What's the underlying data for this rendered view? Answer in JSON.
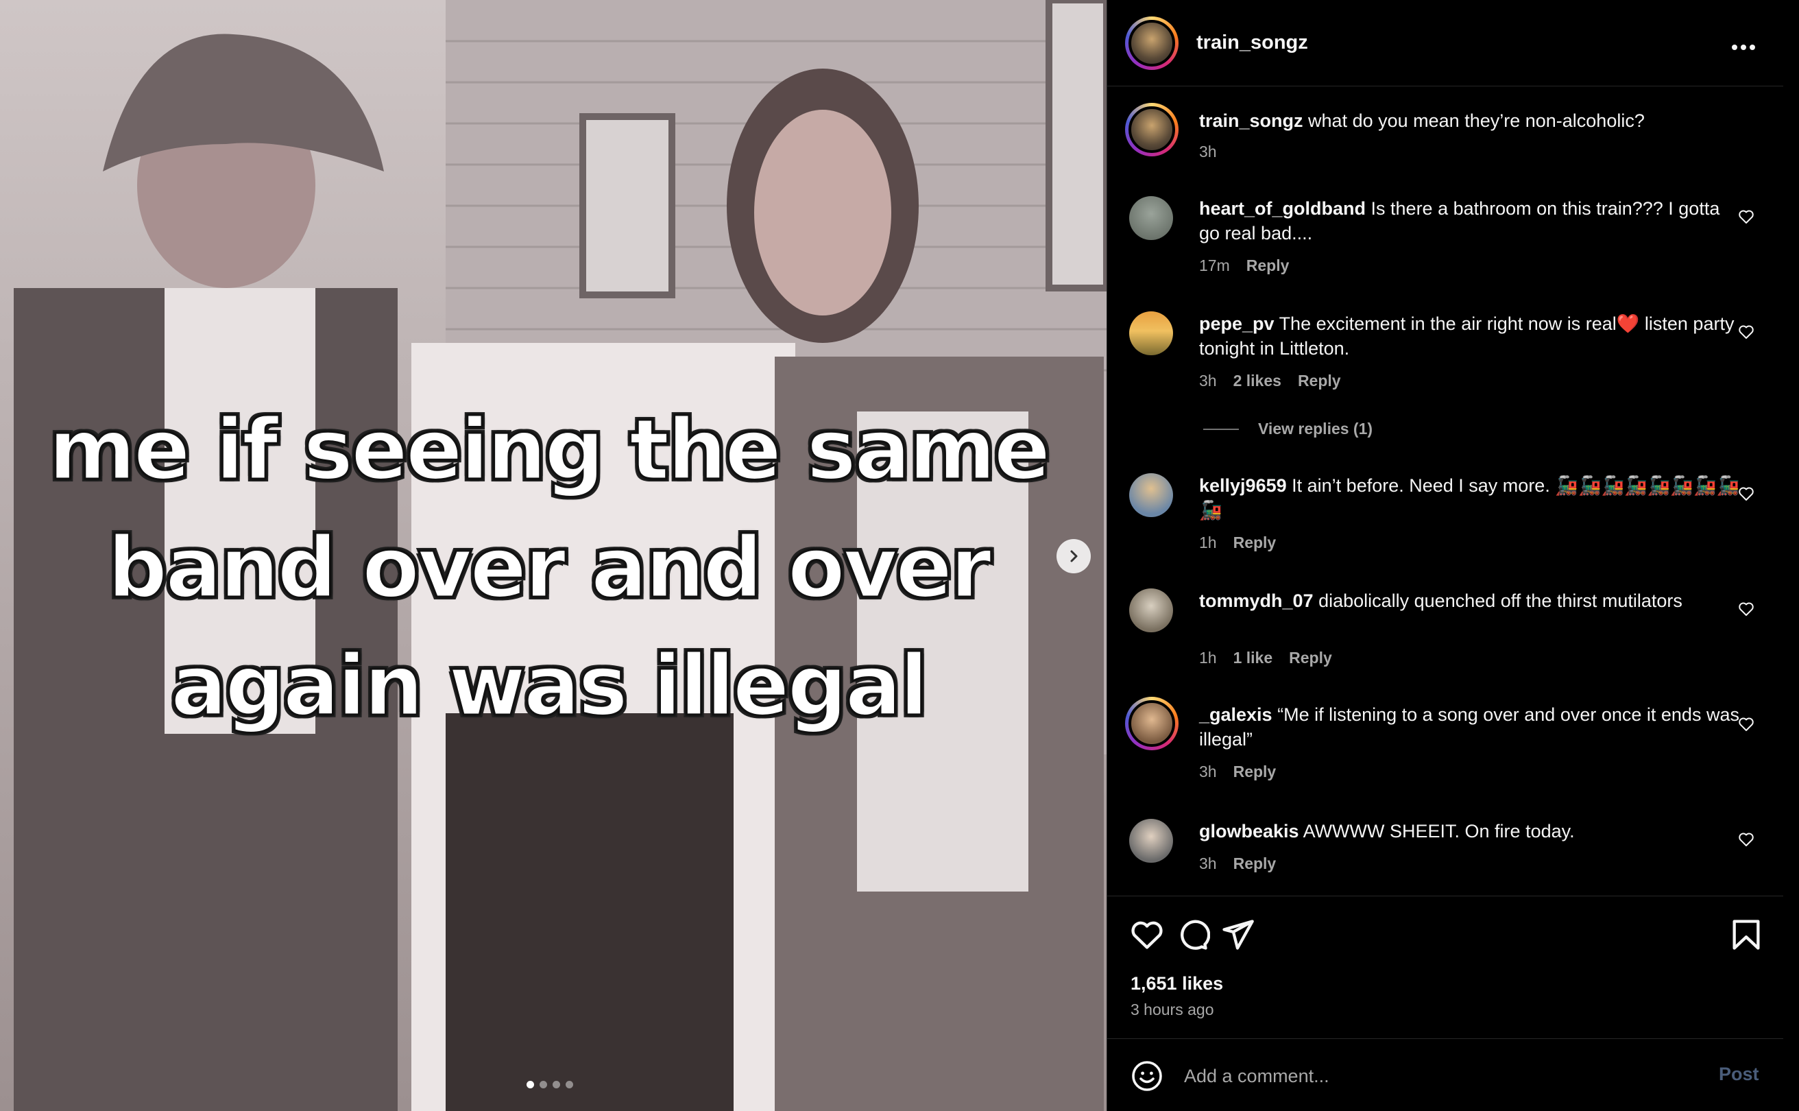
{
  "post": {
    "author": "train_songz",
    "meme_text": "me if seeing the same band over and over again was illegal",
    "carousel": {
      "count": 4,
      "active": 0
    }
  },
  "caption": {
    "username": "train_songz",
    "text": "what do you mean they’re non-alcoholic?",
    "time": "3h"
  },
  "comments": [
    {
      "username": "heart_of_goldband",
      "text": "Is there a bathroom on this train??? I gotta go real bad....",
      "time": "17m",
      "likes": "",
      "reply": "Reply"
    },
    {
      "username": "pepe_pv",
      "text": "The excitement in the air right now is real❤️ listen party tonight in Littleton.",
      "time": "3h",
      "likes": "2 likes",
      "reply": "Reply",
      "view_replies": "View replies (1)"
    },
    {
      "username": "kellyj9659",
      "text": "It ain’t before. Need I say more. 🚂🚂🚂🚂🚂🚂🚂🚂🚂",
      "time": "1h",
      "likes": "",
      "reply": "Reply"
    },
    {
      "username": "tommydh_07",
      "text": "diabolically quenched off the thirst mutilators",
      "time": "1h",
      "likes": "1 like",
      "reply": "Reply"
    },
    {
      "username": "_galexis",
      "text": "“Me if listening to a song over and over once it ends was illegal”",
      "time": "3h",
      "likes": "",
      "reply": "Reply"
    },
    {
      "username": "glowbeakis",
      "text": "AWWWW SHEEIT. On fire today.",
      "time": "3h",
      "likes": "",
      "reply": "Reply"
    }
  ],
  "stats": {
    "likes": "1,651 likes",
    "time_ago": "3 hours ago"
  },
  "composer": {
    "placeholder": "Add a comment...",
    "post_label": "Post"
  },
  "icons": {
    "more": "more-horizontal-icon",
    "next": "chevron-right-icon",
    "like": "heart-icon",
    "comment": "comment-bubble-icon",
    "share": "paper-plane-icon",
    "save": "bookmark-icon",
    "emoji": "smiley-icon"
  },
  "colors": {
    "background": "#000000",
    "muted": "#a8a8a8",
    "post_disabled": "#4a5d7a",
    "divider": "#262626"
  }
}
